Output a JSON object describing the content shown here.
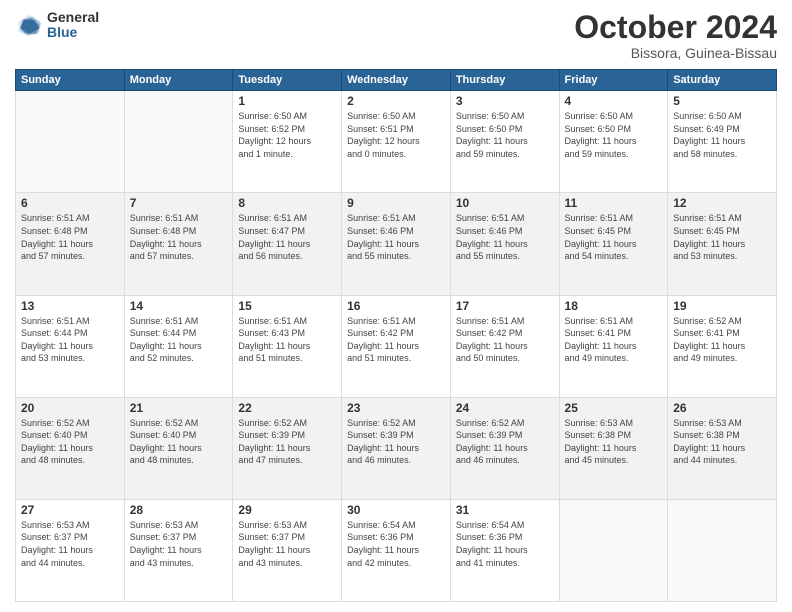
{
  "header": {
    "logo_general": "General",
    "logo_blue": "Blue",
    "title": "October 2024",
    "location": "Bissora, Guinea-Bissau"
  },
  "weekdays": [
    "Sunday",
    "Monday",
    "Tuesday",
    "Wednesday",
    "Thursday",
    "Friday",
    "Saturday"
  ],
  "weeks": [
    [
      {
        "day": "",
        "info": ""
      },
      {
        "day": "",
        "info": ""
      },
      {
        "day": "1",
        "info": "Sunrise: 6:50 AM\nSunset: 6:52 PM\nDaylight: 12 hours\nand 1 minute."
      },
      {
        "day": "2",
        "info": "Sunrise: 6:50 AM\nSunset: 6:51 PM\nDaylight: 12 hours\nand 0 minutes."
      },
      {
        "day": "3",
        "info": "Sunrise: 6:50 AM\nSunset: 6:50 PM\nDaylight: 11 hours\nand 59 minutes."
      },
      {
        "day": "4",
        "info": "Sunrise: 6:50 AM\nSunset: 6:50 PM\nDaylight: 11 hours\nand 59 minutes."
      },
      {
        "day": "5",
        "info": "Sunrise: 6:50 AM\nSunset: 6:49 PM\nDaylight: 11 hours\nand 58 minutes."
      }
    ],
    [
      {
        "day": "6",
        "info": "Sunrise: 6:51 AM\nSunset: 6:48 PM\nDaylight: 11 hours\nand 57 minutes."
      },
      {
        "day": "7",
        "info": "Sunrise: 6:51 AM\nSunset: 6:48 PM\nDaylight: 11 hours\nand 57 minutes."
      },
      {
        "day": "8",
        "info": "Sunrise: 6:51 AM\nSunset: 6:47 PM\nDaylight: 11 hours\nand 56 minutes."
      },
      {
        "day": "9",
        "info": "Sunrise: 6:51 AM\nSunset: 6:46 PM\nDaylight: 11 hours\nand 55 minutes."
      },
      {
        "day": "10",
        "info": "Sunrise: 6:51 AM\nSunset: 6:46 PM\nDaylight: 11 hours\nand 55 minutes."
      },
      {
        "day": "11",
        "info": "Sunrise: 6:51 AM\nSunset: 6:45 PM\nDaylight: 11 hours\nand 54 minutes."
      },
      {
        "day": "12",
        "info": "Sunrise: 6:51 AM\nSunset: 6:45 PM\nDaylight: 11 hours\nand 53 minutes."
      }
    ],
    [
      {
        "day": "13",
        "info": "Sunrise: 6:51 AM\nSunset: 6:44 PM\nDaylight: 11 hours\nand 53 minutes."
      },
      {
        "day": "14",
        "info": "Sunrise: 6:51 AM\nSunset: 6:44 PM\nDaylight: 11 hours\nand 52 minutes."
      },
      {
        "day": "15",
        "info": "Sunrise: 6:51 AM\nSunset: 6:43 PM\nDaylight: 11 hours\nand 51 minutes."
      },
      {
        "day": "16",
        "info": "Sunrise: 6:51 AM\nSunset: 6:42 PM\nDaylight: 11 hours\nand 51 minutes."
      },
      {
        "day": "17",
        "info": "Sunrise: 6:51 AM\nSunset: 6:42 PM\nDaylight: 11 hours\nand 50 minutes."
      },
      {
        "day": "18",
        "info": "Sunrise: 6:51 AM\nSunset: 6:41 PM\nDaylight: 11 hours\nand 49 minutes."
      },
      {
        "day": "19",
        "info": "Sunrise: 6:52 AM\nSunset: 6:41 PM\nDaylight: 11 hours\nand 49 minutes."
      }
    ],
    [
      {
        "day": "20",
        "info": "Sunrise: 6:52 AM\nSunset: 6:40 PM\nDaylight: 11 hours\nand 48 minutes."
      },
      {
        "day": "21",
        "info": "Sunrise: 6:52 AM\nSunset: 6:40 PM\nDaylight: 11 hours\nand 48 minutes."
      },
      {
        "day": "22",
        "info": "Sunrise: 6:52 AM\nSunset: 6:39 PM\nDaylight: 11 hours\nand 47 minutes."
      },
      {
        "day": "23",
        "info": "Sunrise: 6:52 AM\nSunset: 6:39 PM\nDaylight: 11 hours\nand 46 minutes."
      },
      {
        "day": "24",
        "info": "Sunrise: 6:52 AM\nSunset: 6:39 PM\nDaylight: 11 hours\nand 46 minutes."
      },
      {
        "day": "25",
        "info": "Sunrise: 6:53 AM\nSunset: 6:38 PM\nDaylight: 11 hours\nand 45 minutes."
      },
      {
        "day": "26",
        "info": "Sunrise: 6:53 AM\nSunset: 6:38 PM\nDaylight: 11 hours\nand 44 minutes."
      }
    ],
    [
      {
        "day": "27",
        "info": "Sunrise: 6:53 AM\nSunset: 6:37 PM\nDaylight: 11 hours\nand 44 minutes."
      },
      {
        "day": "28",
        "info": "Sunrise: 6:53 AM\nSunset: 6:37 PM\nDaylight: 11 hours\nand 43 minutes."
      },
      {
        "day": "29",
        "info": "Sunrise: 6:53 AM\nSunset: 6:37 PM\nDaylight: 11 hours\nand 43 minutes."
      },
      {
        "day": "30",
        "info": "Sunrise: 6:54 AM\nSunset: 6:36 PM\nDaylight: 11 hours\nand 42 minutes."
      },
      {
        "day": "31",
        "info": "Sunrise: 6:54 AM\nSunset: 6:36 PM\nDaylight: 11 hours\nand 41 minutes."
      },
      {
        "day": "",
        "info": ""
      },
      {
        "day": "",
        "info": ""
      }
    ]
  ]
}
